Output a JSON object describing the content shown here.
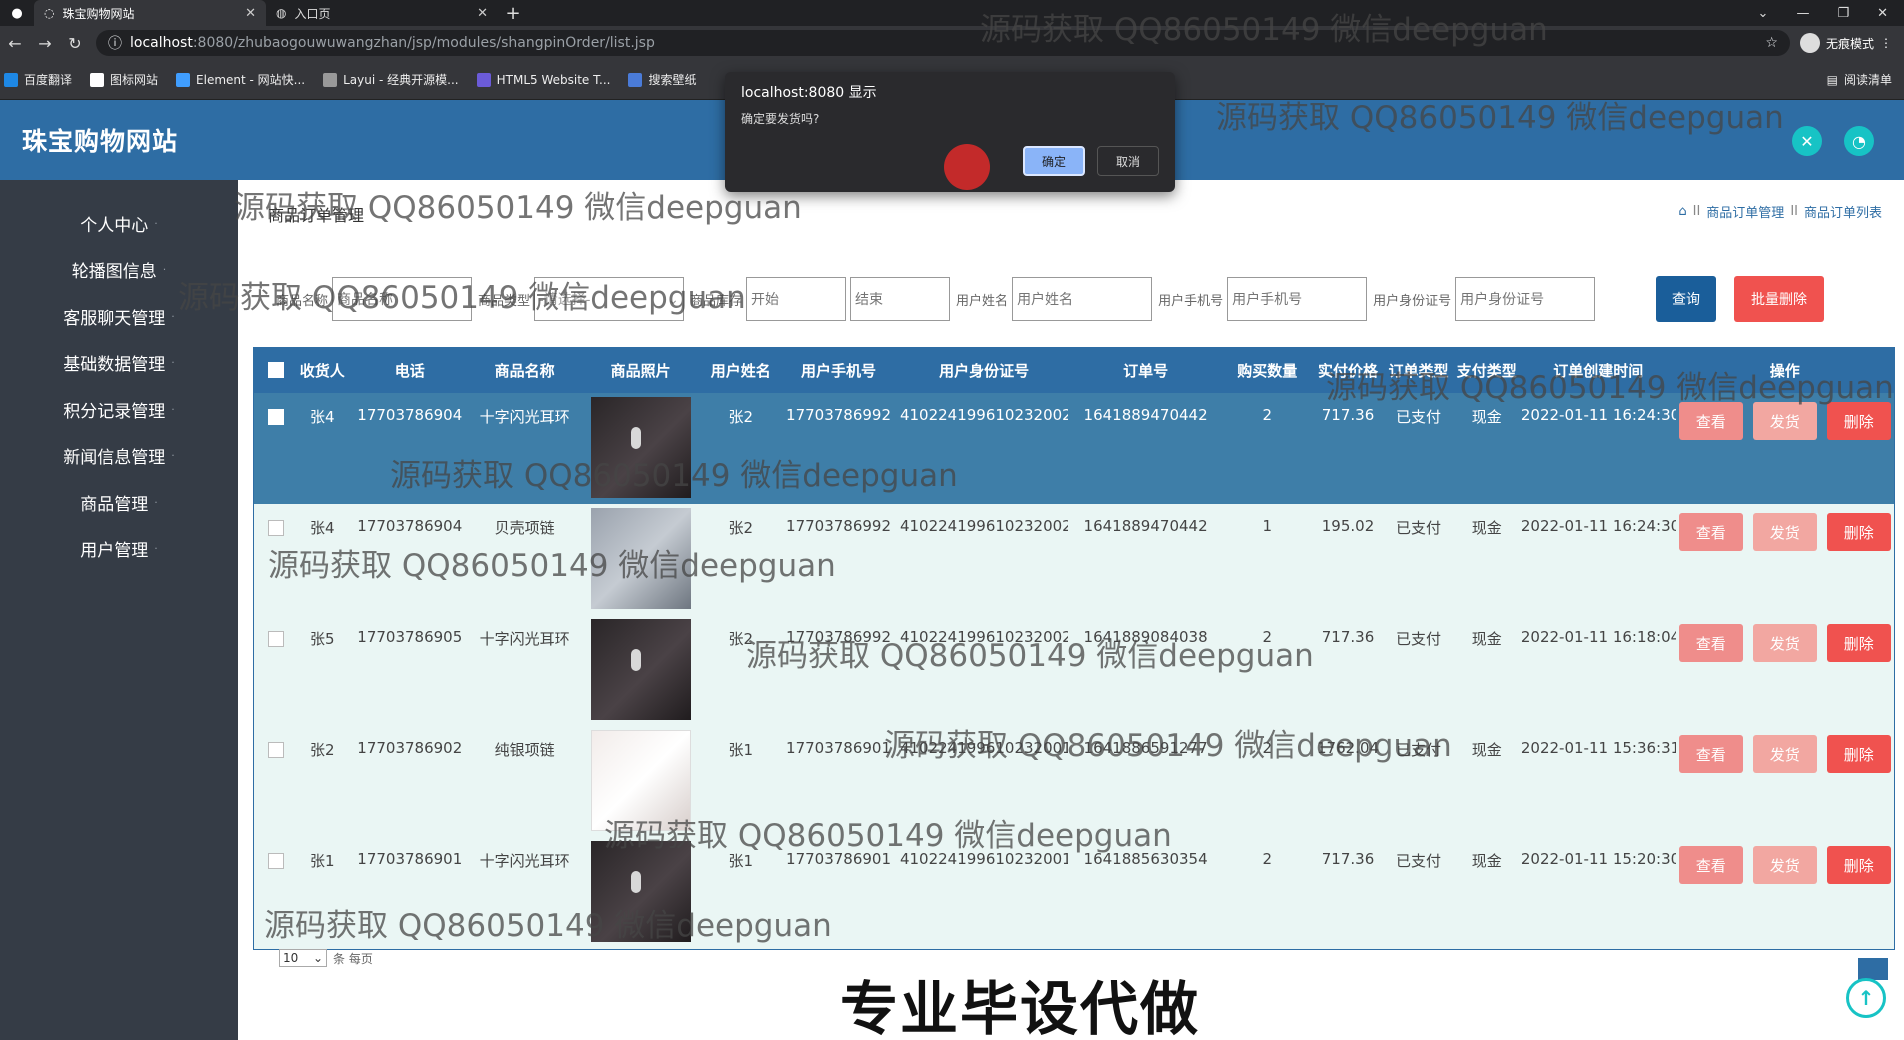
{
  "browser": {
    "tabs": [
      {
        "title": "珠宝购物网站",
        "active": true
      },
      {
        "title": "入口页",
        "active": false
      }
    ],
    "url_host": "localhost",
    "url_rest": ":8080/zhubaogouwuwangzhan/jsp/modules/shangpinOrder/list.jsp",
    "incognito_label": "无痕模式",
    "bookmarks": [
      "百度翻译",
      "图标网站",
      "Element - 网站快...",
      "Layui - 经典开源模...",
      "HTML5 Website T...",
      "搜索壁纸"
    ],
    "reading_list": "阅读清单"
  },
  "dialog": {
    "title": "localhost:8080 显示",
    "message": "确定要发货吗?",
    "ok": "确定",
    "cancel": "取消"
  },
  "app": {
    "title": "珠宝购物网站",
    "icons": [
      "fullscreen-icon",
      "user-icon"
    ]
  },
  "sidebar": {
    "items": [
      "个人中心",
      "轮播图信息",
      "客服聊天管理",
      "基础数据管理",
      "积分记录管理",
      "新闻信息管理",
      "商品管理",
      "用户管理"
    ]
  },
  "page": {
    "heading": "商品订单管理",
    "breadcrumb": [
      "商品订单管理",
      "商品订单列表"
    ],
    "breadcrumb_sep": "II"
  },
  "search": {
    "goods_name_label": "商品名称",
    "goods_name_placeholder": "商品名称",
    "goods_type_label": "商品类型",
    "goods_type_value": "-请选择-",
    "stock_label": "商品库存",
    "stock_start": "开始",
    "stock_end": "结束",
    "user_name_label": "用户姓名",
    "user_name_placeholder": "用户姓名",
    "user_phone_label": "用户手机号",
    "user_phone_placeholder": "用户手机号",
    "user_id_label": "用户身份证号",
    "user_id_placeholder": "用户身份证号",
    "query_btn": "查询",
    "batch_delete_btn": "批量删除"
  },
  "table": {
    "headers": [
      "收货人",
      "电话",
      "商品名称",
      "商品照片",
      "用户姓名",
      "用户手机号",
      "用户身份证号",
      "订单号",
      "购买数量",
      "实付价格",
      "订单类型",
      "支付类型",
      "订单创建时间",
      "操作"
    ],
    "rows": [
      {
        "receiver": "张4",
        "phone": "17703786904",
        "goods": "十字闪光耳环",
        "img": "dark",
        "user": "张2",
        "user_phone": "17703786992",
        "id_card": "410224199610232002",
        "order_no": "1641889470442",
        "qty": "2",
        "price": "717.36",
        "order_type": "已支付",
        "pay_type": "现金",
        "created": "2022-01-11 16:24:30",
        "selected": true
      },
      {
        "receiver": "张4",
        "phone": "17703786904",
        "goods": "贝壳项链",
        "img": "silver",
        "user": "张2",
        "user_phone": "17703786992",
        "id_card": "410224199610232002",
        "order_no": "1641889470442",
        "qty": "1",
        "price": "195.02",
        "order_type": "已支付",
        "pay_type": "现金",
        "created": "2022-01-11 16:24:30",
        "selected": false
      },
      {
        "receiver": "张5",
        "phone": "17703786905",
        "goods": "十字闪光耳环",
        "img": "dark",
        "user": "张2",
        "user_phone": "17703786992",
        "id_card": "410224199610232002",
        "order_no": "1641889084038",
        "qty": "2",
        "price": "717.36",
        "order_type": "已支付",
        "pay_type": "现金",
        "created": "2022-01-11 16:18:04",
        "selected": false
      },
      {
        "receiver": "张2",
        "phone": "17703786902",
        "goods": "纯银项链",
        "img": "light",
        "user": "张1",
        "user_phone": "17703786901",
        "id_card": "410224199610232001",
        "order_no": "1641886591277",
        "qty": "2",
        "price": "1762.04",
        "order_type": "已支付",
        "pay_type": "现金",
        "created": "2022-01-11 15:36:31",
        "selected": false
      },
      {
        "receiver": "张1",
        "phone": "17703786901",
        "goods": "十字闪光耳环",
        "img": "dark",
        "user": "张1",
        "user_phone": "17703786901",
        "id_card": "410224199610232001",
        "order_no": "1641885630354",
        "qty": "2",
        "price": "717.36",
        "order_type": "已支付",
        "pay_type": "现金",
        "created": "2022-01-11 15:20:30",
        "selected": false
      }
    ],
    "actions": {
      "view": "查看",
      "ship": "发货",
      "delete": "删除"
    }
  },
  "pager": {
    "page_size": "10",
    "suffix": "条 每页"
  },
  "watermark_text": "源码获取 QQ86050149 微信deepguan",
  "banner_text": "专业毕设代做"
}
